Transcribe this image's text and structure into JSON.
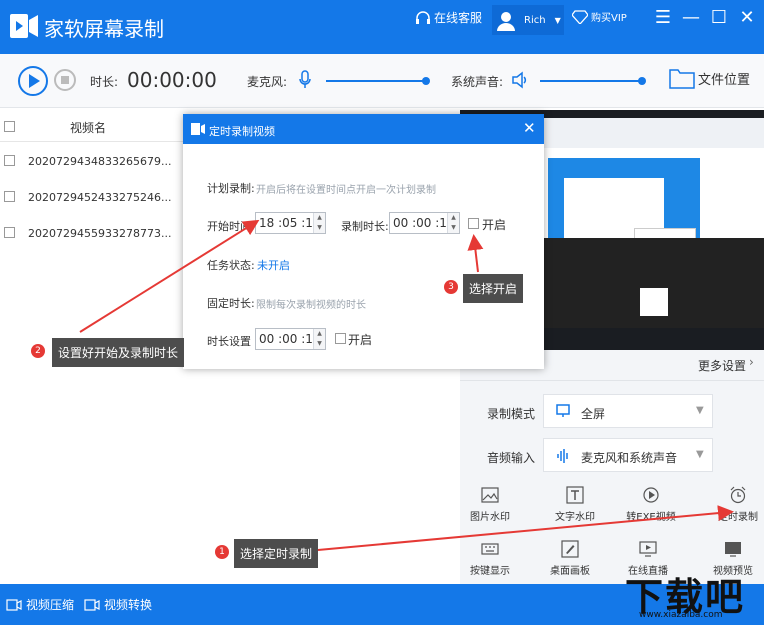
{
  "app": {
    "title": "家软屏幕录制"
  },
  "titlebar": {
    "service": "在线客服",
    "user": "Rich",
    "vip": "购买VIP"
  },
  "toolbar": {
    "duration_label": "时长:",
    "duration_value": "00:00:00",
    "mic_label": "麦克风:",
    "sys_audio_label": "系统声音:",
    "file_location": "文件位置"
  },
  "list": {
    "header": "视频名",
    "rows": [
      "20207294348332656​79...",
      "20207294524332752​46...",
      "20207294559332787​73..."
    ]
  },
  "dialog": {
    "title": "定时录制视频",
    "plan_label": "计划录制:",
    "plan_hint": "开启后将在设置时间点开启一次计划录制",
    "start_label": "开始时间:",
    "start_value": "18 :05 :15",
    "rec_duration_label": "录制时长:",
    "rec_duration_value": "00 :00 :10",
    "enable_label": "开启",
    "status_label": "任务状态:",
    "status_value": "未开启",
    "fixed_label": "固定时长:",
    "fixed_hint": "限制每次录制视频的时长",
    "duration_set_label": "时长设置",
    "duration_set_value": "00 :00 :10",
    "enable_label_2": "开启"
  },
  "panel": {
    "more_settings": "更多设置",
    "mode_label": "录制模式",
    "mode_value": "全屏",
    "audio_label": "音频输入",
    "audio_value": "麦克风和系统声音",
    "tools": [
      "图片水印",
      "文字水印",
      "转EXE视频",
      "定时录制",
      "按键显示",
      "桌面画板",
      "在线直播",
      "视频预览"
    ]
  },
  "statusbar": {
    "compress": "视频压缩",
    "convert": "视频转换"
  },
  "annotations": {
    "step1": "选择定时录制",
    "step2": "设置好开始及录制时长",
    "step3": "选择开启",
    "n1": "1",
    "n2": "2",
    "n3": "3"
  },
  "watermark": {
    "text": "下载吧",
    "url": "www.xiazaiba.com"
  },
  "colors": {
    "primary": "#1478e8",
    "callout": "#4d4d4d",
    "badge": "#e53935",
    "arrow": "#e53935"
  }
}
